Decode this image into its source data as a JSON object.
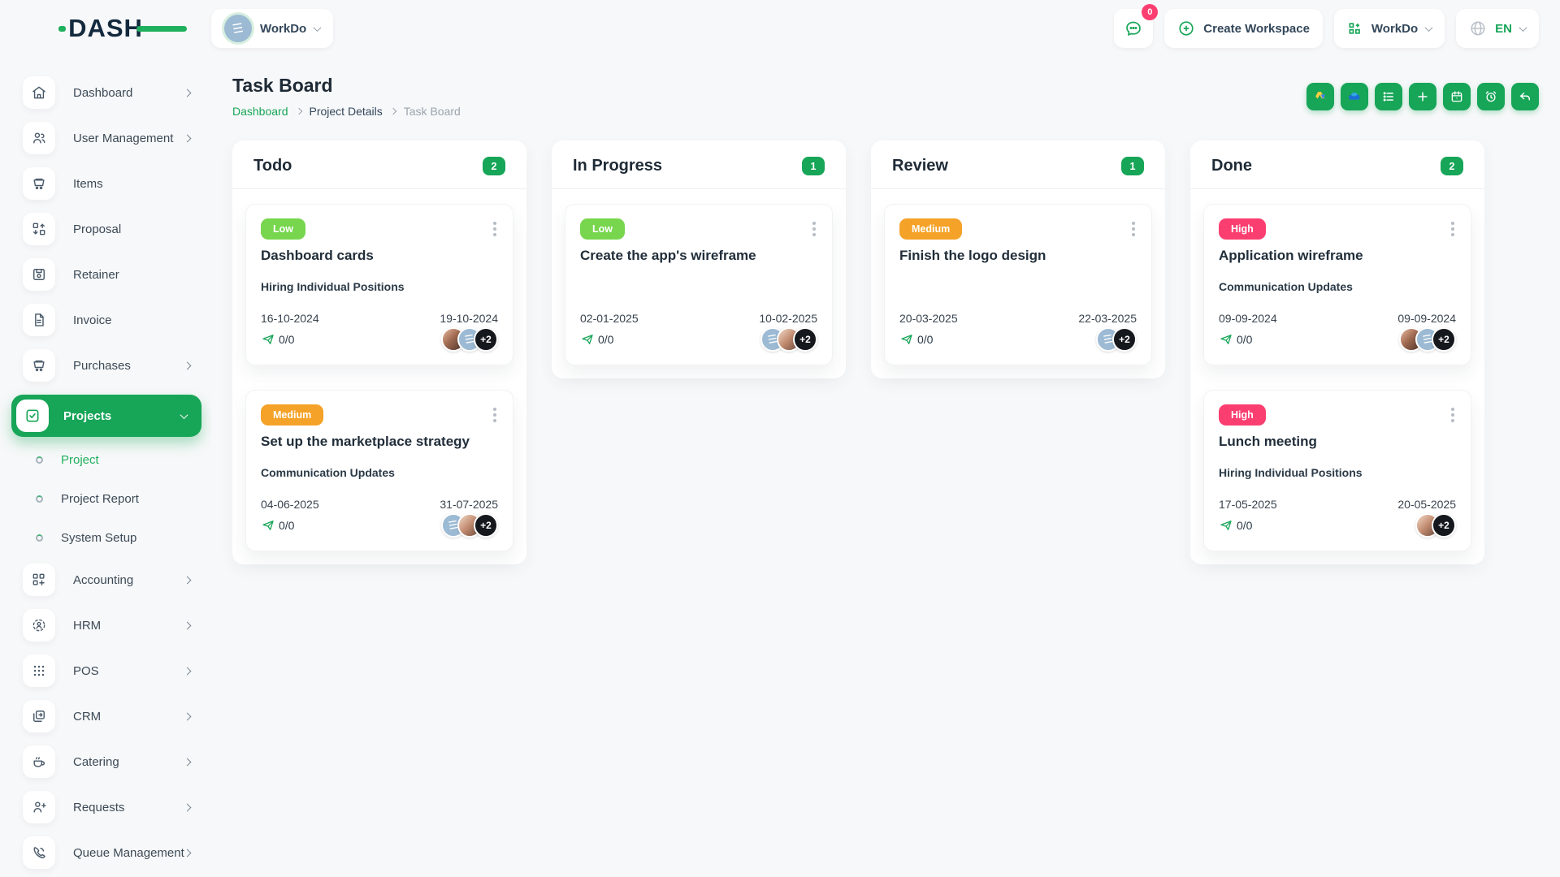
{
  "brand": {
    "logo_text": "DASH"
  },
  "topbar": {
    "workspace": {
      "name": "WorkDo"
    },
    "chat_badge": "0",
    "create_workspace_label": "Create Workspace",
    "workdo_menu_label": "WorkDo",
    "language": "EN"
  },
  "sidebar": {
    "items": [
      {
        "label": "Dashboard"
      },
      {
        "label": "User Management"
      },
      {
        "label": "Items"
      },
      {
        "label": "Proposal"
      },
      {
        "label": "Retainer"
      },
      {
        "label": "Invoice"
      },
      {
        "label": "Purchases"
      },
      {
        "label": "Projects",
        "active": true
      },
      {
        "label": "Accounting"
      },
      {
        "label": "HRM"
      },
      {
        "label": "POS"
      },
      {
        "label": "CRM"
      },
      {
        "label": "Catering"
      },
      {
        "label": "Requests"
      },
      {
        "label": "Queue Management"
      }
    ],
    "projects_submenu": [
      {
        "label": "Project",
        "active": true
      },
      {
        "label": "Project Report"
      },
      {
        "label": "System Setup"
      }
    ]
  },
  "page": {
    "title": "Task Board",
    "breadcrumb": [
      "Dashboard",
      "Project Details",
      "Task Board"
    ]
  },
  "toolbar": {
    "buttons": [
      "google-drive",
      "onedrive",
      "list",
      "add",
      "calendar",
      "timer",
      "undo"
    ]
  },
  "colors": {
    "primary_green": "#17a558",
    "badge_low": "#77d64e",
    "badge_medium": "#f5a228",
    "badge_high": "#fb3e70",
    "notification_pink": "#fb3e70"
  },
  "board": {
    "columns": [
      {
        "title": "Todo",
        "count": "2",
        "cards": [
          {
            "priority": "Low",
            "level": "low",
            "title": "Dashboard cards",
            "milestone": "Hiring Individual Positions",
            "start_date": "16-10-2024",
            "end_date": "19-10-2024",
            "comments": "0/0",
            "extra_count": "+2",
            "avatars": [
              "photo",
              "building",
              "+2"
            ]
          },
          {
            "priority": "Medium",
            "level": "medium",
            "title": "Set up the marketplace strategy",
            "milestone": "Communication Updates",
            "start_date": "04-06-2025",
            "end_date": "31-07-2025",
            "comments": "0/0",
            "extra_count": "+2",
            "avatars": [
              "building",
              "photo2",
              "+2"
            ]
          }
        ]
      },
      {
        "title": "In Progress",
        "count": "1",
        "cards": [
          {
            "priority": "Low",
            "level": "low",
            "title": "Create the app's wireframe",
            "milestone": "",
            "start_date": "02-01-2025",
            "end_date": "10-02-2025",
            "comments": "0/0",
            "extra_count": "+2",
            "avatars": [
              "building",
              "photo2",
              "+2"
            ]
          }
        ]
      },
      {
        "title": "Review",
        "count": "1",
        "cards": [
          {
            "priority": "Medium",
            "level": "medium",
            "title": "Finish the logo design",
            "milestone": "",
            "start_date": "20-03-2025",
            "end_date": "22-03-2025",
            "comments": "0/0",
            "extra_count": "+2",
            "avatars": [
              "building",
              "+2"
            ]
          }
        ]
      },
      {
        "title": "Done",
        "count": "2",
        "cards": [
          {
            "priority": "High",
            "level": "high",
            "title": "Application wireframe",
            "milestone": "Communication Updates",
            "start_date": "09-09-2024",
            "end_date": "09-09-2024",
            "comments": "0/0",
            "extra_count": "+2",
            "avatars": [
              "photo",
              "building",
              "+2"
            ]
          },
          {
            "priority": "High",
            "level": "high",
            "title": "Lunch meeting",
            "milestone": "Hiring Individual Positions",
            "start_date": "17-05-2025",
            "end_date": "20-05-2025",
            "comments": "0/0",
            "extra_count": "+2",
            "avatars": [
              "photo2",
              "+2"
            ]
          }
        ]
      }
    ]
  }
}
